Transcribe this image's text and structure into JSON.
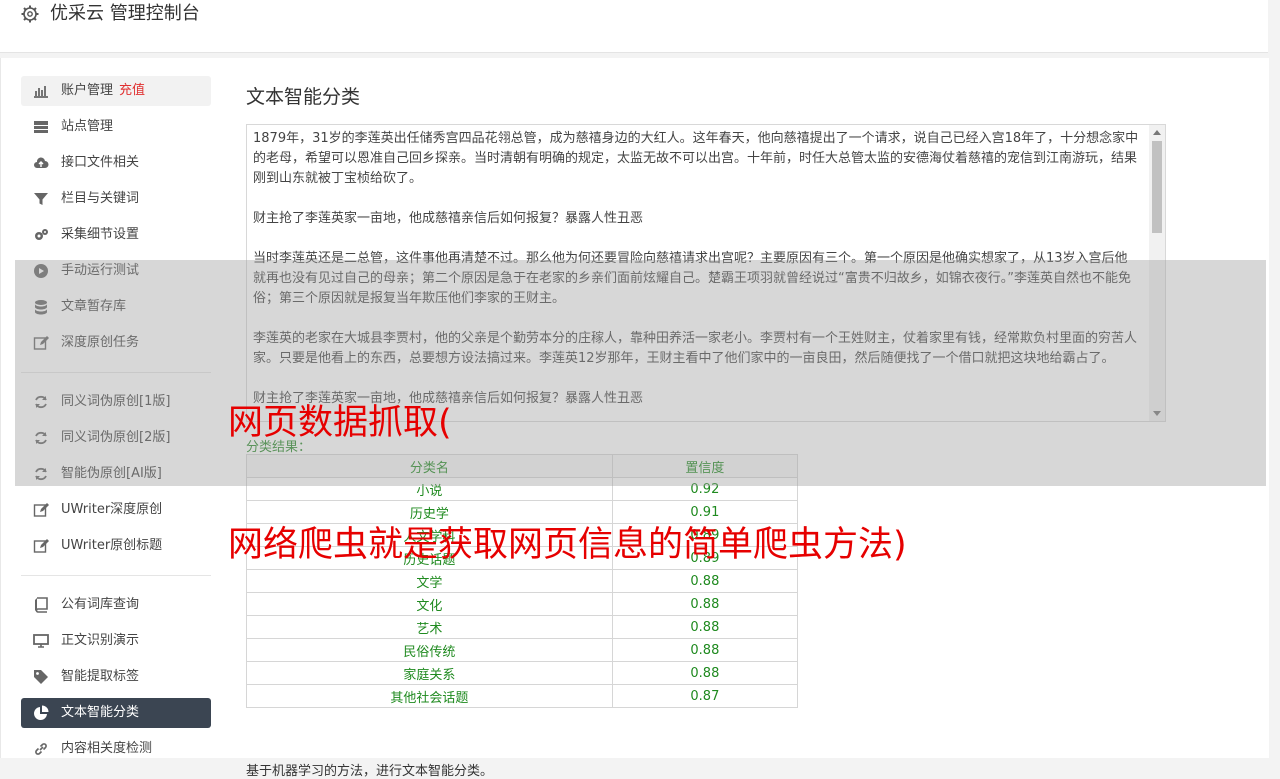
{
  "header": {
    "title": "优采云 管理控制台"
  },
  "sidebar": {
    "recharge_label": "充值",
    "items": [
      {
        "label": "账户管理",
        "icon": "bar-chart-icon"
      },
      {
        "label": "站点管理",
        "icon": "server-icon"
      },
      {
        "label": "接口文件相关",
        "icon": "cloud-upload-icon"
      },
      {
        "label": "栏目与关键词",
        "icon": "filter-icon"
      },
      {
        "label": "采集细节设置",
        "icon": "gears-icon"
      },
      {
        "label": "手动运行测试",
        "icon": "play-circle-icon"
      },
      {
        "label": "文章暂存库",
        "icon": "database-icon"
      },
      {
        "label": "深度原创任务",
        "icon": "edit-icon"
      },
      {
        "label": "同义词伪原创[1版]",
        "icon": "refresh-icon"
      },
      {
        "label": "同义词伪原创[2版]",
        "icon": "refresh-icon"
      },
      {
        "label": "智能伪原创[AI版]",
        "icon": "refresh-icon"
      },
      {
        "label": "UWriter深度原创",
        "icon": "edit-icon"
      },
      {
        "label": "UWriter原创标题",
        "icon": "edit-icon"
      },
      {
        "label": "公有词库查询",
        "icon": "book-icon"
      },
      {
        "label": "正文识别演示",
        "icon": "monitor-icon"
      },
      {
        "label": "智能提取标签",
        "icon": "tag-icon"
      },
      {
        "label": "文本智能分类",
        "icon": "pie-chart-icon"
      },
      {
        "label": "内容相关度检测",
        "icon": "link-icon"
      }
    ]
  },
  "main": {
    "title": "文本智能分类",
    "text_paragraphs": [
      "1879年，31岁的李莲英出任储秀宫四品花翎总管，成为慈禧身边的大红人。这年春天，他向慈禧提出了一个请求，说自己已经入宫18年了，十分想念家中的老母，希望可以恩准自己回乡探亲。当时清朝有明确的规定，太监无故不可以出宫。十年前，时任大总管太监的安德海仗着慈禧的宠信到江南游玩，结果刚到山东就被丁宝桢给砍了。",
      "财主抢了李莲英家一亩地，他成慈禧亲信后如何报复？暴露人性丑恶",
      "当时李莲英还是二总管，这件事他再清楚不过。那么他为何还要冒险向慈禧请求出宫呢？主要原因有三个。第一个原因是他确实想家了，从13岁入宫后他就再也没有见过自己的母亲；第二个原因是急于在老家的乡亲们面前炫耀自己。楚霸王项羽就曾经说过“富贵不归故乡，如锦衣夜行。”李莲英自然也不能免俗；第三个原因就是报复当年欺压他们李家的王财主。",
      "李莲英的老家在大城县李贾村，他的父亲是个勤劳本分的庄稼人，靠种田养活一家老小。李贾村有一个王姓财主，仗着家里有钱，经常欺负村里面的穷苦人家。只要是他看上的东西，总要想方设法搞过来。李莲英12岁那年，王财主看中了他们家中的一亩良田，然后随便找了一个借口就把这块地给霸占了。",
      "财主抢了李莲英家一亩地，他成慈禧亲信后如何报复？暴露人性丑恶"
    ],
    "result_label": "分类结果：",
    "table_headers": [
      "分类名",
      "置信度"
    ],
    "rows": [
      {
        "name": "小说",
        "score": "0.92"
      },
      {
        "name": "历史学",
        "score": "0.91"
      },
      {
        "name": "人文学科",
        "score": "0.89"
      },
      {
        "name": "历史话题",
        "score": "0.89"
      },
      {
        "name": "文学",
        "score": "0.88"
      },
      {
        "name": "文化",
        "score": "0.88"
      },
      {
        "name": "艺术",
        "score": "0.88"
      },
      {
        "name": "民俗传统",
        "score": "0.88"
      },
      {
        "name": "家庭关系",
        "score": "0.88"
      },
      {
        "name": "其他社会话题",
        "score": "0.87"
      }
    ],
    "footnote": "基于机器学习的方法，进行文本智能分类。"
  },
  "overlay": {
    "line1": "网页数据抓取(",
    "line2": "网络爬虫就是获取网页信息的简单爬虫方法)"
  }
}
